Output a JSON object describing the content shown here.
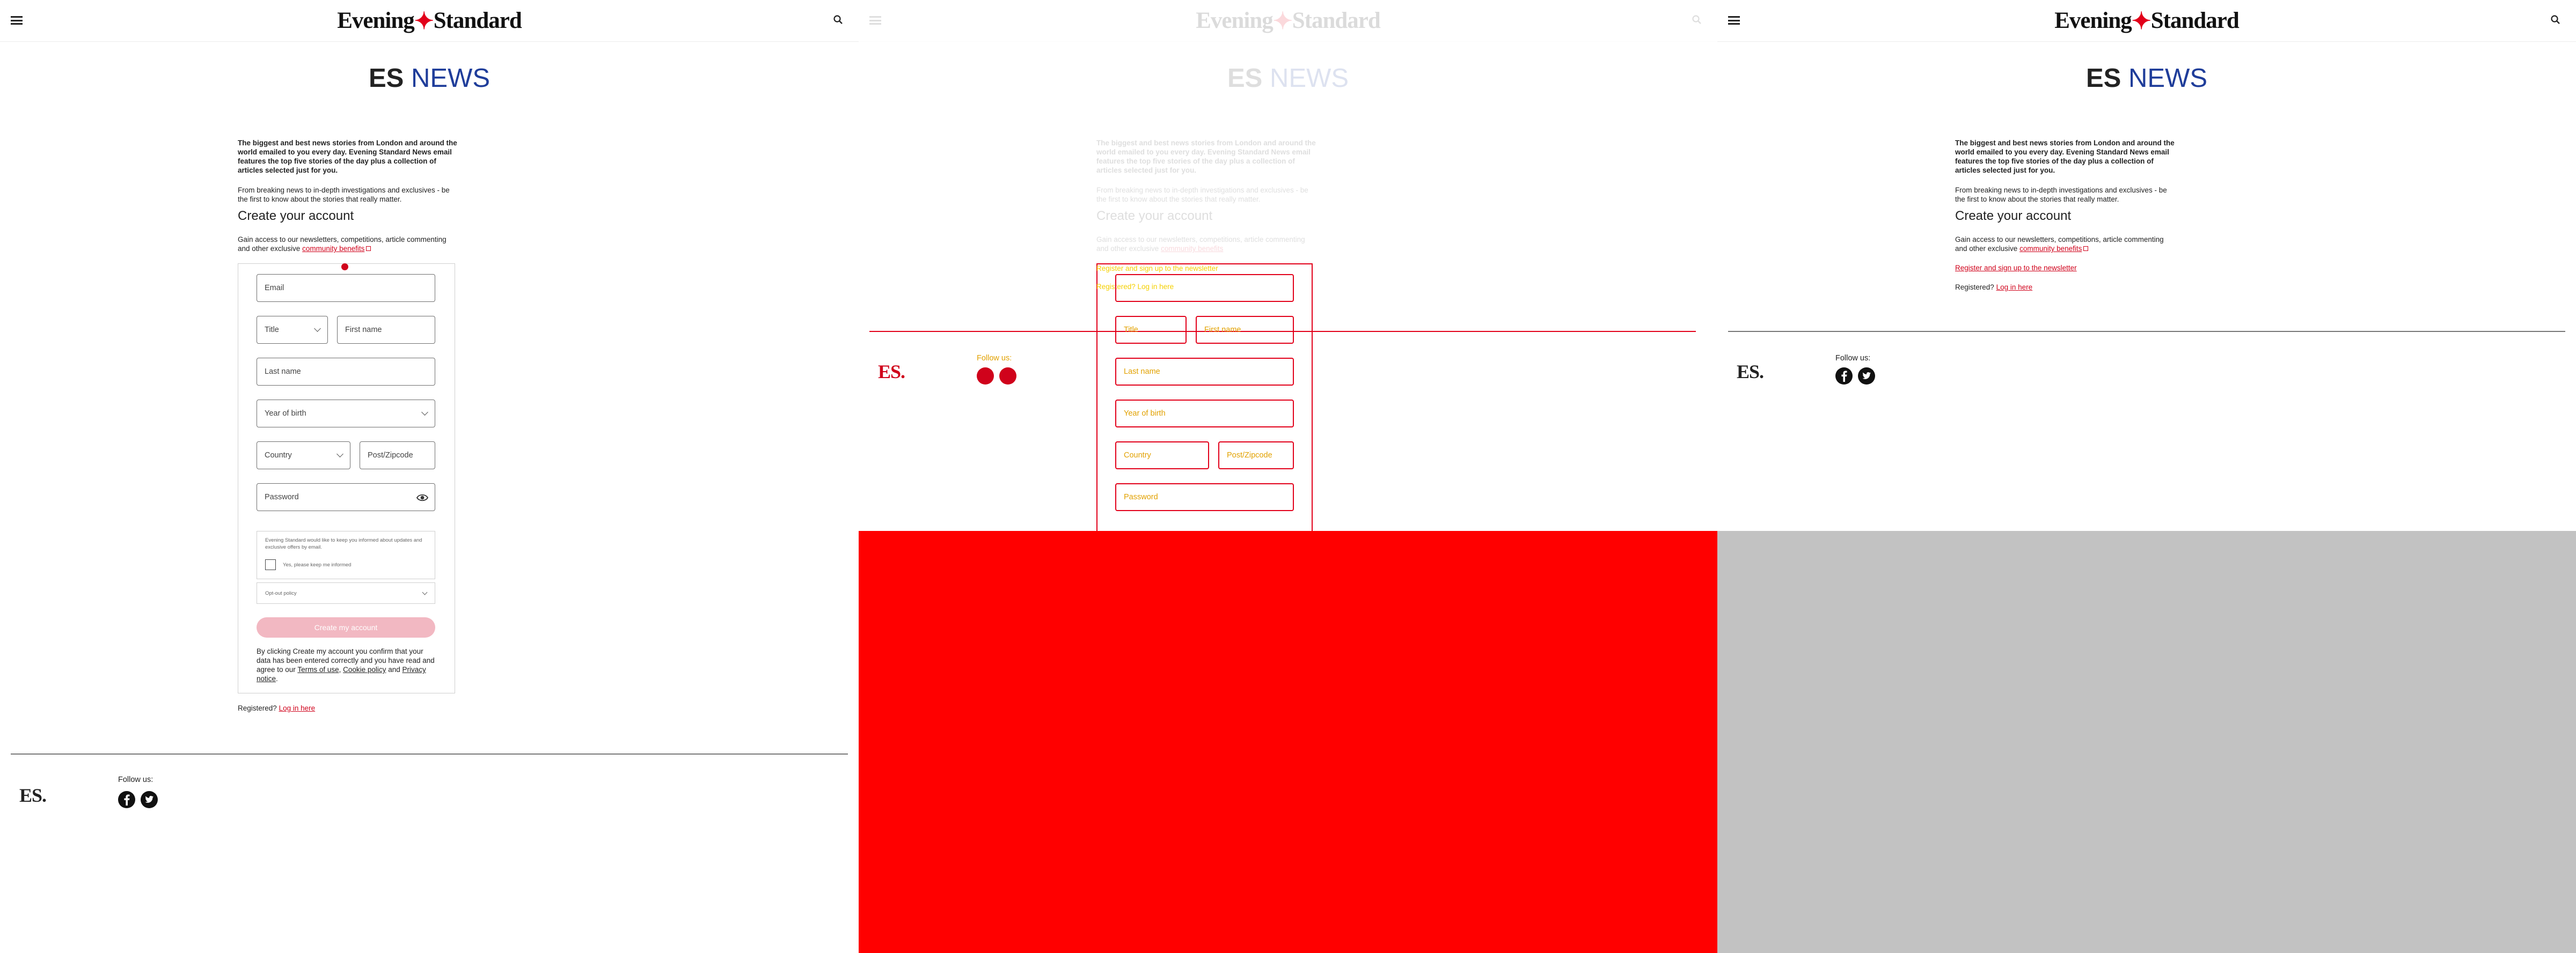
{
  "header": {
    "logo_left": "Evening",
    "logo_mark": "✦",
    "logo_right": "Standard"
  },
  "page": {
    "title_bold": "ES",
    "title_rest": "NEWS"
  },
  "intro": {
    "bold_text": "The biggest and best news stories from London and around the world emailed to you every day. Evening Standard News email features the top five stories of the day plus a collection of articles selected just for you.",
    "text": "From breaking news to in-depth investigations and exclusives - be the first to know about the stories that really matter."
  },
  "account": {
    "heading": "Create your account",
    "gain_text": "Gain access to our newsletters, competitions, article commenting and other exclusive",
    "benefits_link": "community benefits"
  },
  "form": {
    "email": "Email",
    "title": "Title",
    "first_name": "First name",
    "last_name": "Last name",
    "year_of_birth": "Year of birth",
    "country": "Country",
    "postcode": "Post/Zipcode",
    "password": "Password",
    "consent_text": "Evening Standard would like to keep you informed about updates and exclusive offers by email.",
    "consent_checkbox": "Yes, please keep me informed",
    "opt_out": "Opt-out policy",
    "create_button": "Create my account",
    "terms_prefix": "By clicking Create my account you confirm that your data has been entered correctly and you have read and agree to our",
    "terms_link": "Terms of use",
    "cookie_link": "Cookie policy",
    "and": "and",
    "privacy_link": "Privacy notice"
  },
  "registered": {
    "text": "Registered?",
    "link": "Log in here"
  },
  "register_link": "Register and sign up to the newsletter",
  "footer": {
    "logo": "ES.",
    "follow": "Follow us:"
  },
  "overlay": {
    "register_text": "Register and sign up to the newsletter",
    "registered_text": "Registered? Log in here"
  },
  "colors": {
    "accent": "#d0021b",
    "news_blue": "#1f3d9a",
    "button_pink": "#f2b8c2",
    "overlay_red": "#ff0000",
    "overlay_yellow": "#f5d000",
    "gray": "#c2c2c2"
  },
  "icons": [
    "menu-icon",
    "search-icon",
    "eye-icon",
    "facebook-icon",
    "twitter-icon",
    "external-link-icon",
    "chevron-down-icon"
  ]
}
